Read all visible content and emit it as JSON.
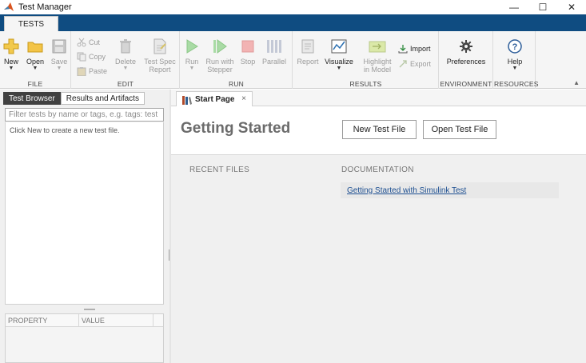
{
  "window": {
    "title": "Test Manager",
    "controls": {
      "minimize": "—",
      "maximize": "☐",
      "close": "✕"
    }
  },
  "ribbon": {
    "active_tab": "TESTS",
    "groups": {
      "file": {
        "label": "FILE",
        "new": "New",
        "open": "Open",
        "save": "Save"
      },
      "edit": {
        "label": "EDIT",
        "cut": "Cut",
        "copy": "Copy",
        "paste": "Paste",
        "delete": "Delete",
        "test_spec_report_line1": "Test Spec",
        "test_spec_report_line2": "Report"
      },
      "run": {
        "label": "RUN",
        "run": "Run",
        "run_with_stepper_line1": "Run with",
        "run_with_stepper_line2": "Stepper",
        "stop": "Stop",
        "parallel": "Parallel"
      },
      "results": {
        "label": "RESULTS",
        "report": "Report",
        "visualize": "Visualize",
        "highlight_line1": "Highlight",
        "highlight_line2": "in Model",
        "import": "Import",
        "export": "Export"
      },
      "environment": {
        "label": "ENVIRONMENT",
        "preferences": "Preferences"
      },
      "resources": {
        "label": "RESOURCES",
        "help": "Help"
      }
    }
  },
  "left_panel": {
    "tabs": [
      "Test Browser",
      "Results and Artifacts"
    ],
    "active_tab_index": 0,
    "filter_placeholder": "Filter tests by name or tags, e.g. tags: test",
    "empty_hint": "Click New to create a new test file.",
    "property_columns": [
      "PROPERTY",
      "VALUE"
    ]
  },
  "document": {
    "tab_label": "Start Page",
    "tab_close": "×",
    "heading": "Getting Started",
    "buttons": {
      "new_test_file": "New Test File",
      "open_test_file": "Open Test File"
    },
    "sections": {
      "recent_files": "RECENT FILES",
      "documentation": "DOCUMENTATION"
    },
    "doc_links": [
      "Getting Started with Simulink Test"
    ]
  },
  "colors": {
    "tabstrip_blue": "#0f4c81",
    "link_blue": "#1d4f91",
    "heading_gray": "#6b6b6b"
  }
}
